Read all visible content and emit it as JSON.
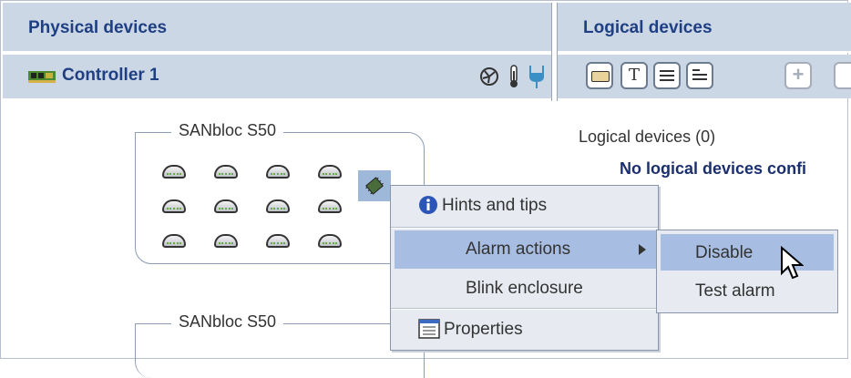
{
  "panels": {
    "physical_title": "Physical devices",
    "logical_title": "Logical devices"
  },
  "controller": {
    "label": "Controller 1",
    "icons": [
      "controller-card-icon",
      "fan-icon",
      "thermometer-icon",
      "power-plug-icon"
    ]
  },
  "toolbar": {
    "icons": [
      "disk-view-icon",
      "text-view-icon",
      "list-view-icon",
      "detail-view-icon",
      "add-icon"
    ]
  },
  "enclosures": [
    {
      "name": "SANbloc S50",
      "disk_rows": 3,
      "disk_cols": 4
    },
    {
      "name": "SANbloc S50"
    }
  ],
  "logical": {
    "count_label": "Logical devices (0)",
    "empty_message": "No logical devices confi"
  },
  "context_menu": {
    "hints": "Hints and tips",
    "alarm": "Alarm actions",
    "blink": "Blink enclosure",
    "properties": "Properties"
  },
  "alarm_submenu": {
    "disable": "Disable",
    "test": "Test alarm"
  },
  "colors": {
    "header_bg": "#ccd7e6",
    "header_text": "#1f3f83",
    "menu_bg": "#e7ebf1",
    "highlight": "#a7bde2"
  }
}
